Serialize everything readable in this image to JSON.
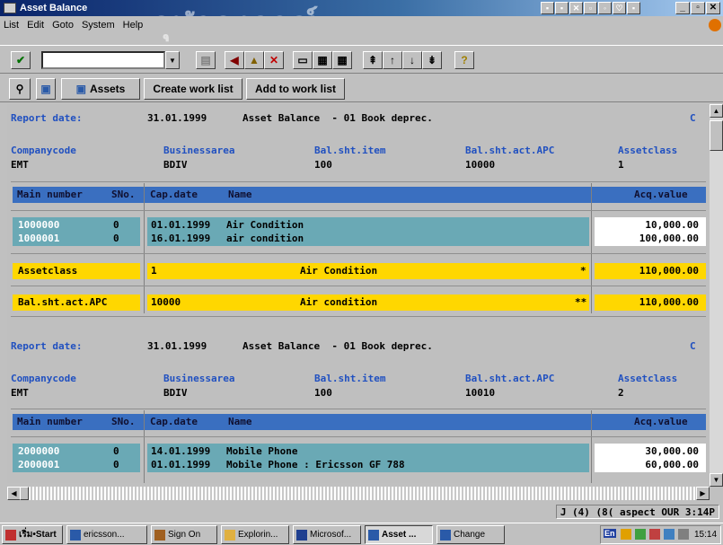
{
  "window": {
    "title": "Asset Balance",
    "watermark": "จุฬาลงกรณ์"
  },
  "menu": [
    "List",
    "Edit",
    "Goto",
    "System",
    "Help"
  ],
  "toolbar": {
    "command_value": "",
    "help_glyph": "?"
  },
  "app_toolbar": {
    "assets_label": "Assets",
    "create_work_list": "Create work list",
    "add_to_work_list": "Add to work list"
  },
  "report": {
    "sections": [
      {
        "report_date_label": "Report date:",
        "report_date": "31.01.1999",
        "report_title": "Asset Balance  - 01 Book deprec.",
        "corner_letter": "C",
        "hdr_company": "Companycode",
        "hdr_busarea": "Businessarea",
        "hdr_balitem": "Bal.sht.item",
        "hdr_balapc": "Bal.sht.act.APC",
        "hdr_assetclass": "Assetclass",
        "val_company": "EMT",
        "val_busarea": "BDIV",
        "val_balitem": "100",
        "val_balapc": "10000",
        "val_assetclass": "1",
        "col_main": "Main number",
        "col_sno": "SNo.",
        "col_capdate": "Cap.date",
        "col_name": "Name",
        "col_acq": "Acq.value",
        "rows": [
          {
            "main": "1000000",
            "sno": "0",
            "capdate": "01.01.1999",
            "name": "Air Condition",
            "acq": "10,000.00"
          },
          {
            "main": "1000001",
            "sno": "0",
            "capdate": "16.01.1999",
            "name": "air condition",
            "acq": "100,000.00"
          }
        ],
        "sum1_label": "Assetclass",
        "sum1_key": "1",
        "sum1_name": "Air Condition",
        "sum1_mark": "*",
        "sum1_value": "110,000.00",
        "sum2_label": "Bal.sht.act.APC",
        "sum2_key": "10000",
        "sum2_name": "Air condition",
        "sum2_mark": "**",
        "sum2_value": "110,000.00"
      },
      {
        "report_date_label": "Report date:",
        "report_date": "31.01.1999",
        "report_title": "Asset Balance  - 01 Book deprec.",
        "corner_letter": "C",
        "hdr_company": "Companycode",
        "hdr_busarea": "Businessarea",
        "hdr_balitem": "Bal.sht.item",
        "hdr_balapc": "Bal.sht.act.APC",
        "hdr_assetclass": "Assetclass",
        "val_company": "EMT",
        "val_busarea": "BDIV",
        "val_balitem": "100",
        "val_balapc": "10010",
        "val_assetclass": "2",
        "col_main": "Main number",
        "col_sno": "SNo.",
        "col_capdate": "Cap.date",
        "col_name": "Name",
        "col_acq": "Acq.value",
        "rows": [
          {
            "main": "2000000",
            "sno": "0",
            "capdate": "14.01.1999",
            "name": "Mobile Phone",
            "acq": "30,000.00"
          },
          {
            "main": "2000001",
            "sno": "0",
            "capdate": "01.01.1999",
            "name": "Mobile Phone : Ericsson GF 788",
            "acq": "60,000.00"
          }
        ]
      }
    ]
  },
  "status_bar": {
    "text": "J (4) (8( aspect OUR 3:14P"
  },
  "taskbar": {
    "start": "เริ่ม•Start",
    "tasks": [
      "ericsson...",
      "Sign On",
      "Explorin...",
      "Microsof...",
      "Asset ...",
      "Change",
      "En"
    ],
    "clock": "15:14"
  },
  "colors": {
    "header_blue": "#3a6fc0",
    "row_teal": "#6aa9b5",
    "total_yellow": "#ffd700",
    "label_blue": "#2050c0"
  }
}
